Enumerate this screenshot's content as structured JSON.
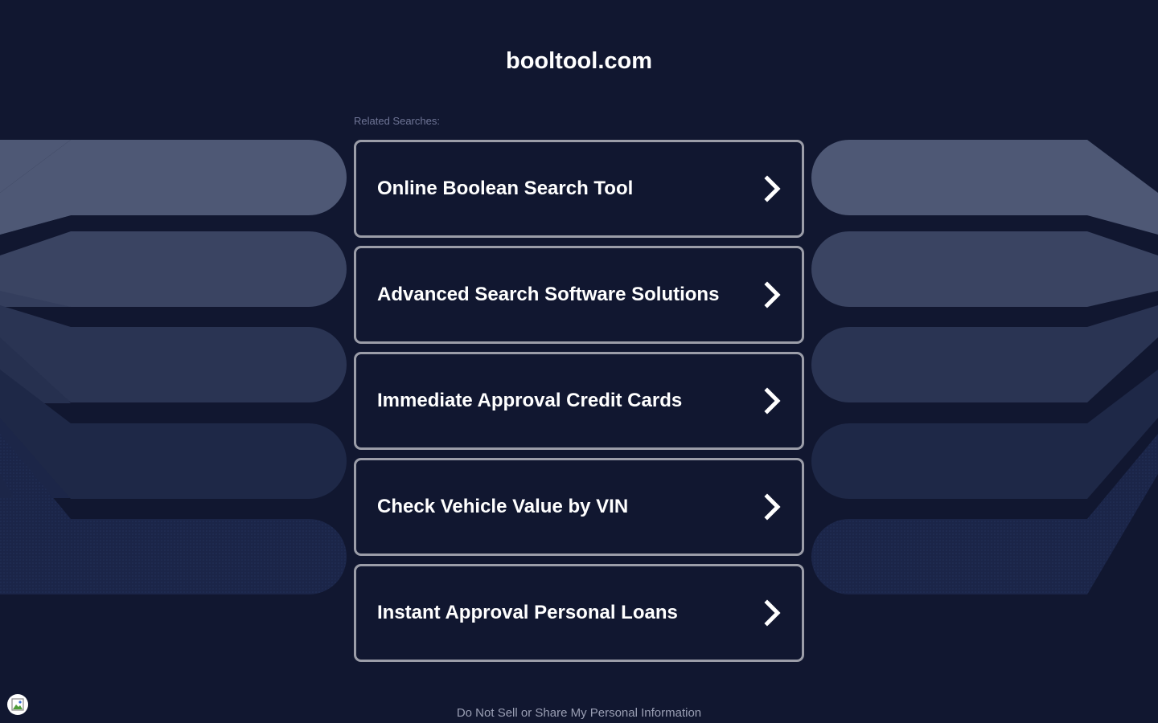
{
  "site": {
    "title": "booltool.com"
  },
  "related": {
    "label": "Related Searches:",
    "items": [
      {
        "label": "Online Boolean Search Tool"
      },
      {
        "label": "Advanced Search Software Solutions"
      },
      {
        "label": "Immediate Approval Credit Cards"
      },
      {
        "label": "Check Vehicle Value by VIN"
      },
      {
        "label": "Instant Approval Personal Loans"
      }
    ],
    "item_icon": "chevron-right-icon"
  },
  "footer": {
    "privacy_link": "Do Not Sell or Share My Personal Information",
    "privacy_badge_icon": "broken-image-icon"
  },
  "colors": {
    "background": "#111730",
    "item_border": "#9b9da8",
    "text": "#ffffff",
    "muted_text": "#6f7596",
    "footer_text": "#9a9fb4",
    "band_1": "#4e5875",
    "band_2": "#3a4462",
    "band_3": "#2a3453",
    "band_4": "#1e2847",
    "band_5": "#19254a"
  }
}
